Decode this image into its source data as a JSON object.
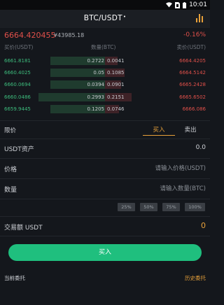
{
  "status_bar": {
    "time": "10:01"
  },
  "nav": {
    "title": "BTC/USDT",
    "title_suffix": "•"
  },
  "ticker": {
    "last_price": "6664.420455",
    "cny_price": "¥43985.18",
    "change": "-0.16%"
  },
  "orderbook": {
    "headers": {
      "bid": "买价(USDT)",
      "qty": "数量(BTC)",
      "ask": "卖价(USDT)"
    },
    "rows": [
      {
        "bid_price": "6661.8181",
        "bid_qty": "0.2722",
        "ask_qty": "0.0041",
        "ask_price": "6664.4205",
        "bid_depth": 0.62,
        "ask_depth": 0.14
      },
      {
        "bid_price": "6660.4025",
        "bid_qty": "0.05",
        "ask_qty": "0.1085",
        "ask_price": "6664.5142",
        "bid_depth": 0.62,
        "ask_depth": 0.22
      },
      {
        "bid_price": "6660.0694",
        "bid_qty": "0.0394",
        "ask_qty": "0.0901",
        "ask_price": "6665.2428",
        "bid_depth": 0.62,
        "ask_depth": 0.18
      },
      {
        "bid_price": "6660.0486",
        "bid_qty": "0.2993",
        "ask_qty": "0.2151",
        "ask_price": "6665.6502",
        "bid_depth": 0.76,
        "ask_depth": 0.3
      },
      {
        "bid_price": "6659.9445",
        "bid_qty": "0.1205",
        "ask_qty": "0.0746",
        "ask_price": "6666.086",
        "bid_depth": 0.62,
        "ask_depth": 0.16
      }
    ]
  },
  "form": {
    "order_type": "限价",
    "tabs": {
      "buy": "买入",
      "sell": "卖出"
    },
    "balance_label": "USDT资产",
    "balance_value": "0.0",
    "price_label": "价格",
    "price_placeholder": "请输入价格(USDT)",
    "qty_label": "数量",
    "qty_placeholder": "请输入数量(BTC)",
    "percent_buttons": [
      "25%",
      "50%",
      "75%",
      "100%"
    ],
    "amount_label": "交易额 USDT",
    "amount_value": "0",
    "submit_label": "买入"
  },
  "orders": {
    "current": "当前委托",
    "history": "历史委托"
  },
  "colors": {
    "up": "#3dbd7d",
    "down": "#e0504a",
    "accent": "#e8a13a",
    "buy_button": "#1fbf7e"
  }
}
